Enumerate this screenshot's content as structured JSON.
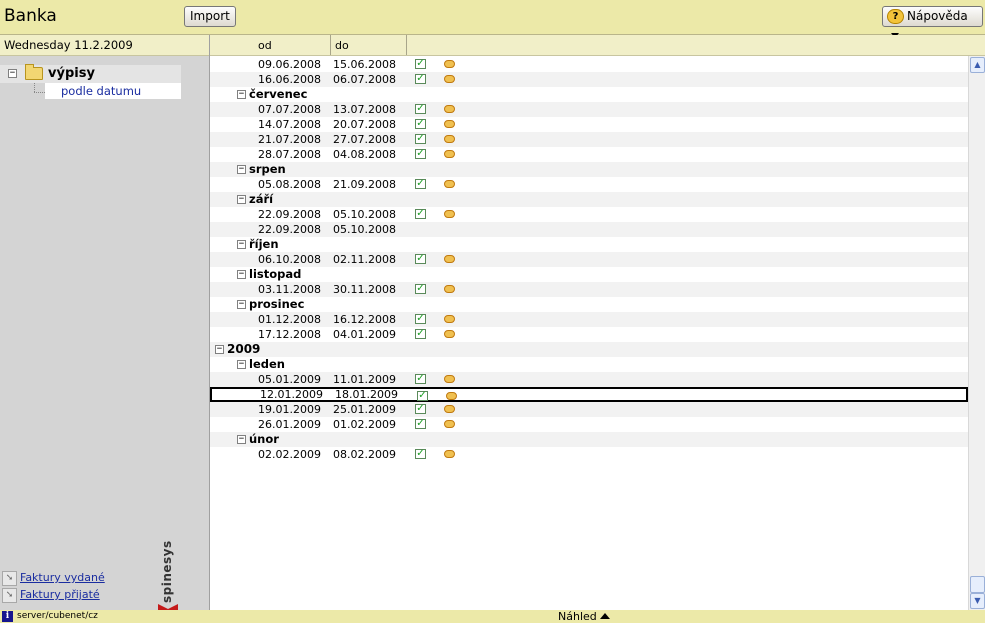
{
  "header": {
    "title": "Banka",
    "import_label": "Import",
    "help_label": "Nápověda"
  },
  "sidebar": {
    "date": "Wednesday 11.2.2009",
    "tree_root": "výpisy",
    "tree_child": "podle datumu",
    "brand": "spinesys",
    "links": [
      "Faktury vydané",
      "Faktury přijaté"
    ]
  },
  "table": {
    "col_od": "od",
    "col_do": "do",
    "rows": [
      {
        "type": "entry",
        "od": "09.06.2008",
        "do": "15.06.2008",
        "icons": true
      },
      {
        "type": "entry",
        "od": "16.06.2008",
        "do": "06.07.2008",
        "icons": true
      },
      {
        "type": "month",
        "label": "červenec"
      },
      {
        "type": "entry",
        "od": "07.07.2008",
        "do": "13.07.2008",
        "icons": true
      },
      {
        "type": "entry",
        "od": "14.07.2008",
        "do": "20.07.2008",
        "icons": true
      },
      {
        "type": "entry",
        "od": "21.07.2008",
        "do": "27.07.2008",
        "icons": true
      },
      {
        "type": "entry",
        "od": "28.07.2008",
        "do": "04.08.2008",
        "icons": true
      },
      {
        "type": "month",
        "label": "srpen"
      },
      {
        "type": "entry",
        "od": "05.08.2008",
        "do": "21.09.2008",
        "icons": true
      },
      {
        "type": "month",
        "label": "září"
      },
      {
        "type": "entry",
        "od": "22.09.2008",
        "do": "05.10.2008",
        "icons": true
      },
      {
        "type": "entry",
        "od": "22.09.2008",
        "do": "05.10.2008",
        "icons": false
      },
      {
        "type": "month",
        "label": "říjen"
      },
      {
        "type": "entry",
        "od": "06.10.2008",
        "do": "02.11.2008",
        "icons": true
      },
      {
        "type": "month",
        "label": "listopad"
      },
      {
        "type": "entry",
        "od": "03.11.2008",
        "do": "30.11.2008",
        "icons": true
      },
      {
        "type": "month",
        "label": "prosinec"
      },
      {
        "type": "entry",
        "od": "01.12.2008",
        "do": "16.12.2008",
        "icons": true
      },
      {
        "type": "entry",
        "od": "17.12.2008",
        "do": "04.01.2009",
        "icons": true
      },
      {
        "type": "year",
        "label": "2009"
      },
      {
        "type": "month",
        "label": "leden"
      },
      {
        "type": "entry",
        "od": "05.01.2009",
        "do": "11.01.2009",
        "icons": true
      },
      {
        "type": "entry",
        "od": "12.01.2009",
        "do": "18.01.2009",
        "icons": true,
        "selected": true
      },
      {
        "type": "entry",
        "od": "19.01.2009",
        "do": "25.01.2009",
        "icons": true
      },
      {
        "type": "entry",
        "od": "26.01.2009",
        "do": "01.02.2009",
        "icons": true
      },
      {
        "type": "month",
        "label": "únor"
      },
      {
        "type": "entry",
        "od": "02.02.2009",
        "do": "08.02.2009",
        "icons": true
      }
    ]
  },
  "status": {
    "path": "server/cubenet/cz",
    "preview_label": "Náhled"
  },
  "icons": {
    "check": "check-icon",
    "coin": "coins-icon",
    "help": "help-icon"
  },
  "colors": {
    "bar": "#ece9a8",
    "header_strip": "#f1efc8",
    "link": "#1a2da0",
    "sidebar": "#d4d4d4"
  }
}
